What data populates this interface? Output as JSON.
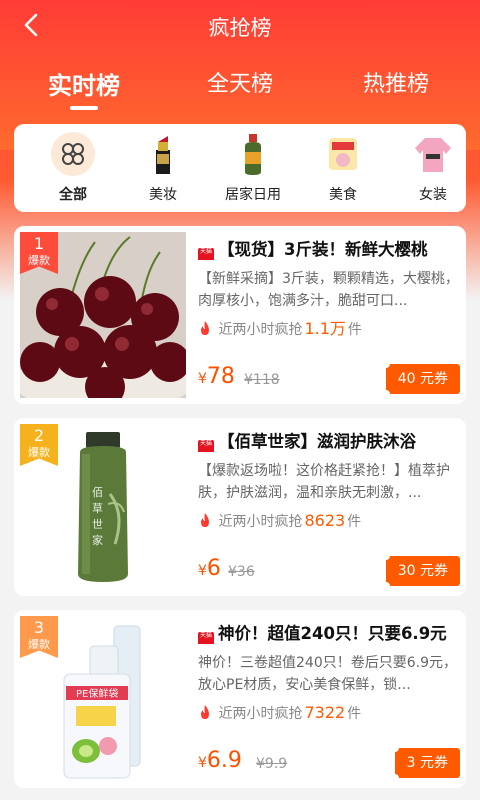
{
  "header": {
    "title": "疯抢榜"
  },
  "tabs": [
    {
      "label": "实时榜",
      "active": true
    },
    {
      "label": "全天榜",
      "active": false
    },
    {
      "label": "热推榜",
      "active": false
    }
  ],
  "categories": [
    {
      "label": "全部",
      "icon": "clover-icon",
      "active": true
    },
    {
      "label": "美妆",
      "icon": "lipstick-icon",
      "active": false
    },
    {
      "label": "居家日用",
      "icon": "bottle-icon",
      "active": false
    },
    {
      "label": "美食",
      "icon": "snack-icon",
      "active": false
    },
    {
      "label": "女装",
      "icon": "sweater-icon",
      "active": false
    }
  ],
  "products": [
    {
      "rank": "1",
      "rank_tag": "爆款",
      "platform_badge": "天猫",
      "title": "【现货】3斤装！新鲜大樱桃",
      "desc": "【新鲜采摘】3斤装，颗颗精选，大樱桃，肉厚核小，饱满多汁，脆甜可口...",
      "sold_prefix": "近两小时疯抢",
      "sold_count": "1.1万",
      "sold_suffix": "件",
      "currency": "¥",
      "price": "78",
      "orig_price": "¥118",
      "coupon": "40 元券",
      "image": "cherries-image"
    },
    {
      "rank": "2",
      "rank_tag": "爆款",
      "platform_badge": "天猫",
      "title": "【佰草世家】滋润护肤沐浴",
      "desc": "【爆款返场啦！这价格赶紧抢！】植萃护肤，护肤滋润，温和亲肤无刺激，...",
      "sold_prefix": "近两小时疯抢",
      "sold_count": "8623",
      "sold_suffix": "件",
      "currency": "¥",
      "price": "6",
      "orig_price": "¥36",
      "coupon": "30 元券",
      "image": "shower-gel-image"
    },
    {
      "rank": "3",
      "rank_tag": "爆款",
      "platform_badge": "天猫",
      "title": "神价！超值240只！只要6.9元",
      "desc": "神价！三卷超值240只！卷后只要6.9元，放心PE材质，安心美食保鲜，锁...",
      "sold_prefix": "近两小时疯抢",
      "sold_count": "7322",
      "sold_suffix": "件",
      "currency": "¥",
      "price": "6.9",
      "orig_price": "¥9.9",
      "coupon": "3 元券",
      "image": "cling-wrap-image"
    }
  ],
  "colors": {
    "header_red": "#ff3c36",
    "accent_orange": "#ff5a00",
    "rank1": "#ff4b3a",
    "rank2": "#f5b21d",
    "rank3": "#ff9a4c"
  }
}
